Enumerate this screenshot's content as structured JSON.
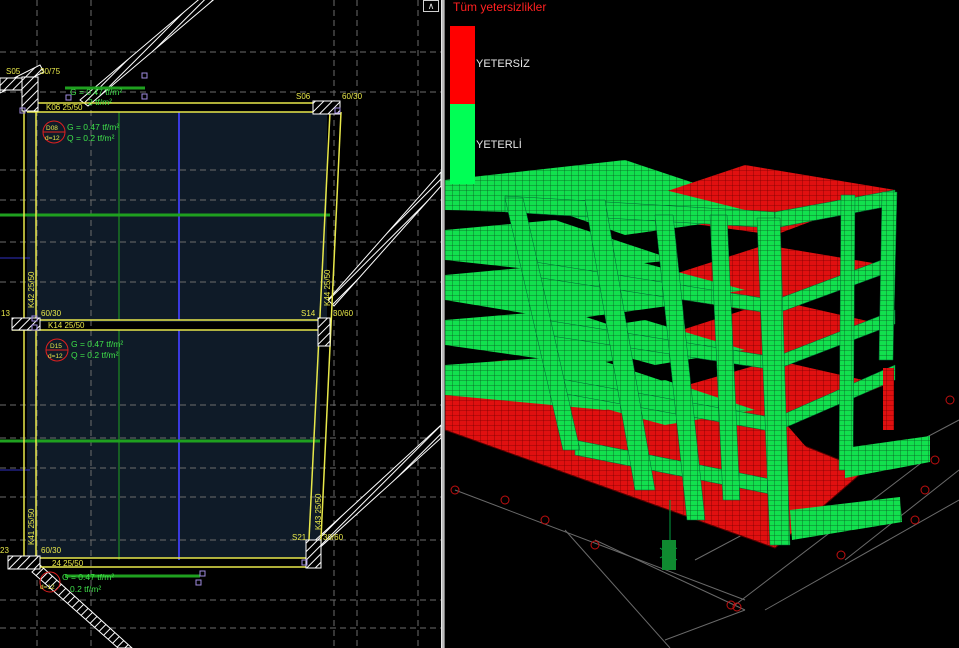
{
  "plan_view": {
    "close_glyph": "∧",
    "columns": {
      "s05": "S05",
      "s05_size": "30/75",
      "s06": "S06",
      "s06_size": "60/30",
      "s13": "13",
      "s13_size": "60/30",
      "s14": "S14",
      "s14_size": "30/60",
      "s20": "23",
      "s20_size": "60/30",
      "s21": "S21",
      "s21_size": "30/60"
    },
    "beams": {
      "top": "K06 25/50",
      "mid": "K14 25/50",
      "bottom": "24 25/50",
      "left_upper": "K42 25/50",
      "left_lower": "K41 25/50",
      "right_upper": "K44 25/50",
      "right_lower": "K43 25/50"
    },
    "slabs": {
      "top_partial": {
        "g": "G = 0.47  tf/m²",
        "q": "2 tf/m²"
      },
      "d08": {
        "id": "D08",
        "thickness": "d=12",
        "g": "G = 0.47  tf/m²",
        "q": "Q = 0.2  tf/m²"
      },
      "d15": {
        "id": "D15",
        "thickness": "d=12",
        "g": "G = 0.47  tf/m²",
        "q": "Q = 0.2  tf/m²"
      },
      "bottom_partial": {
        "thickness": "d=12",
        "g": "G = 0.47  tf/m²",
        "q": "0.2  tf/m²"
      }
    }
  },
  "model_view": {
    "legend": {
      "title": "Tüm yetersizlikler",
      "insufficient_label": "YETERSİZ",
      "sufficient_label": "YETERLİ",
      "insufficient_color": "#ff0000",
      "sufficient_color": "#00ff55"
    },
    "colors": {
      "member_green": "#10e050",
      "slab_red": "#e01010",
      "mesh_dark": "#0a3010"
    }
  }
}
